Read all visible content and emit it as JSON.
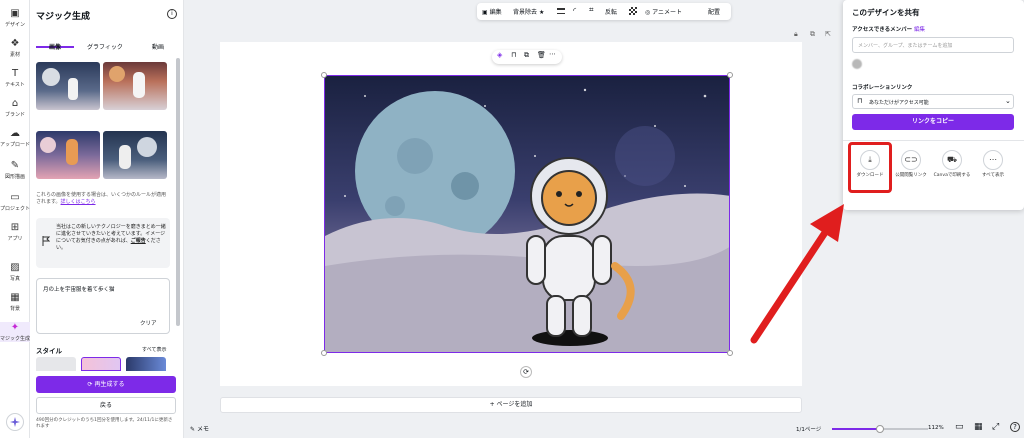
{
  "rail": {
    "items": [
      {
        "label": "デザイン",
        "icon": "design-icon"
      },
      {
        "label": "素材",
        "icon": "elements-icon"
      },
      {
        "label": "テキスト",
        "icon": "text-icon"
      },
      {
        "label": "ブランド",
        "icon": "brand-icon"
      },
      {
        "label": "アップロード",
        "icon": "upload-icon"
      },
      {
        "label": "図形描画",
        "icon": "draw-icon"
      },
      {
        "label": "プロジェクト",
        "icon": "folder-icon"
      },
      {
        "label": "アプリ",
        "icon": "apps-icon"
      },
      {
        "label": "写真",
        "icon": "photo-icon"
      },
      {
        "label": "背景",
        "icon": "background-icon"
      },
      {
        "label": "マジック生成",
        "icon": "magic-icon"
      }
    ]
  },
  "panel": {
    "title": "マジック生成",
    "tabs": [
      "画像",
      "グラフィック",
      "動画"
    ],
    "notice": "これらの画像を使用する場合は、いくつかのルールが適用されます。",
    "notice_link": "詳しくはこちら",
    "info_prefix": "当社はこの新しいテクノロジーを磨きまとめ一緒に進化させていきたいと考えています。イメージについてお気付きの点があれば、",
    "info_link": "ご報告",
    "info_suffix": "ください。",
    "prompt": "月の上を宇宙服を着て歩く猫",
    "clear": "クリア",
    "style_label": "スタイル",
    "see_all": "すべて表示",
    "regen": "再生成する",
    "back": "戻る",
    "credits": "490回分のクレジットのうち1回分を使用します。24/11/1に更新されます"
  },
  "toolbar": {
    "edit": "編集",
    "bg_remove": "背景除去",
    "flip": "反転",
    "animate": "アニメート",
    "arrange": "配置"
  },
  "canvas": {
    "add_page": "+ ページを追加"
  },
  "bottom": {
    "memo": "メモ",
    "pages": "1/1ページ",
    "zoom": "112%",
    "zoom_fraction": 0.5
  },
  "share": {
    "title": "このデザインを共有",
    "access_label": "アクセスできるメンバー",
    "edit_link": "編集",
    "member_placeholder": "メンバー、グループ、またはチームを追加",
    "collab_label": "コラボレーションリンク",
    "access_option": "あなただけがアクセス可能",
    "copy_link": "リンクをコピー",
    "actions": [
      {
        "label": "ダウンロード",
        "icon": "download-icon"
      },
      {
        "label": "公開閲覧リンク",
        "icon": "link-icon"
      },
      {
        "label": "Canvaで印刷する",
        "icon": "print-truck-icon"
      },
      {
        "label": "すべて表示",
        "icon": "more-icon"
      }
    ]
  },
  "colors": {
    "accent": "#7d2ae8",
    "highlight": "#e01e1e"
  }
}
